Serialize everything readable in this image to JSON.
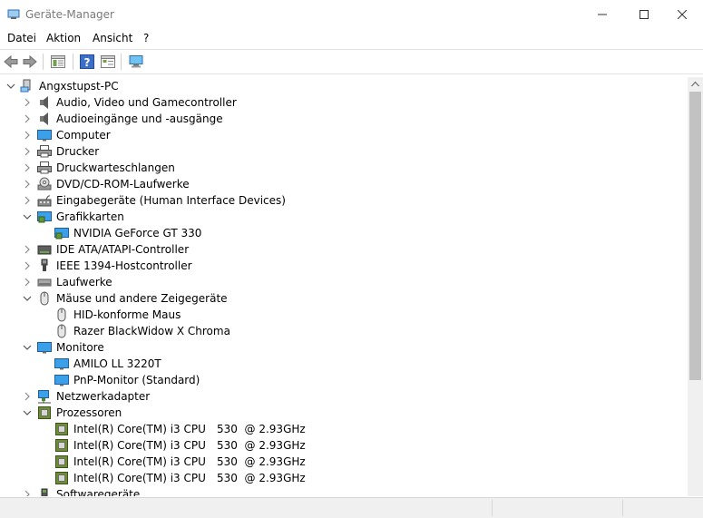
{
  "window": {
    "title": "Geräte-Manager"
  },
  "menu": [
    "Datei",
    "Aktion",
    "Ansicht",
    "?"
  ],
  "tree": [
    {
      "label": "Angxstupst-PC",
      "expanded": true,
      "icon": "computer-root-icon"
    },
    {
      "label": "Audio, Video und Gamecontroller",
      "expanded": false,
      "icon": "speaker-icon"
    },
    {
      "label": "Audioeingänge und -ausgänge",
      "expanded": false,
      "icon": "speaker-icon"
    },
    {
      "label": "Computer",
      "expanded": false,
      "icon": "monitor-icon"
    },
    {
      "label": "Drucker",
      "expanded": false,
      "icon": "printer-icon"
    },
    {
      "label": "Druckwarteschlangen",
      "expanded": false,
      "icon": "printer-icon"
    },
    {
      "label": "DVD/CD-ROM-Laufwerke",
      "expanded": false,
      "icon": "disc-drive-icon"
    },
    {
      "label": "Eingabegeräte (Human Interface Devices)",
      "expanded": false,
      "icon": "hid-icon"
    },
    {
      "label": "Grafikkarten",
      "expanded": true,
      "icon": "display-adapter-icon"
    },
    {
      "label": "NVIDIA GeForce GT 330",
      "child": true,
      "icon": "display-adapter-icon"
    },
    {
      "label": "IDE ATA/ATAPI-Controller",
      "expanded": false,
      "icon": "ide-icon"
    },
    {
      "label": "IEEE 1394-Hostcontroller",
      "expanded": false,
      "icon": "usb-plug-icon"
    },
    {
      "label": "Laufwerke",
      "expanded": false,
      "icon": "disk-drive-icon"
    },
    {
      "label": "Mäuse und andere Zeigegeräte",
      "expanded": true,
      "icon": "mouse-icon"
    },
    {
      "label": "HID-konforme Maus",
      "child": true,
      "icon": "mouse-icon"
    },
    {
      "label": "Razer BlackWidow X Chroma",
      "child": true,
      "icon": "mouse-icon"
    },
    {
      "label": "Monitore",
      "expanded": true,
      "icon": "monitor-icon"
    },
    {
      "label": "AMILO LL 3220T",
      "child": true,
      "icon": "monitor-icon"
    },
    {
      "label": "PnP-Monitor (Standard)",
      "child": true,
      "icon": "monitor-icon"
    },
    {
      "label": "Netzwerkadapter",
      "expanded": false,
      "icon": "network-icon"
    },
    {
      "label": "Prozessoren",
      "expanded": true,
      "icon": "cpu-icon"
    },
    {
      "label": "Intel(R) Core(TM) i3 CPU",
      "suffix": "530  @ 2.93GHz",
      "child": true,
      "icon": "cpu-icon"
    },
    {
      "label": "Intel(R) Core(TM) i3 CPU",
      "suffix": "530  @ 2.93GHz",
      "child": true,
      "icon": "cpu-icon"
    },
    {
      "label": "Intel(R) Core(TM) i3 CPU",
      "suffix": "530  @ 2.93GHz",
      "child": true,
      "icon": "cpu-icon"
    },
    {
      "label": "Intel(R) Core(TM) i3 CPU",
      "suffix": "530  @ 2.93GHz",
      "child": true,
      "icon": "cpu-icon"
    },
    {
      "label": "Softwaregeräte",
      "expanded": false,
      "icon": "software-device-icon"
    }
  ],
  "colors": {
    "monitor": "#1e88e5",
    "cpu": "#5a7d2a",
    "accent": "#0078d7"
  }
}
